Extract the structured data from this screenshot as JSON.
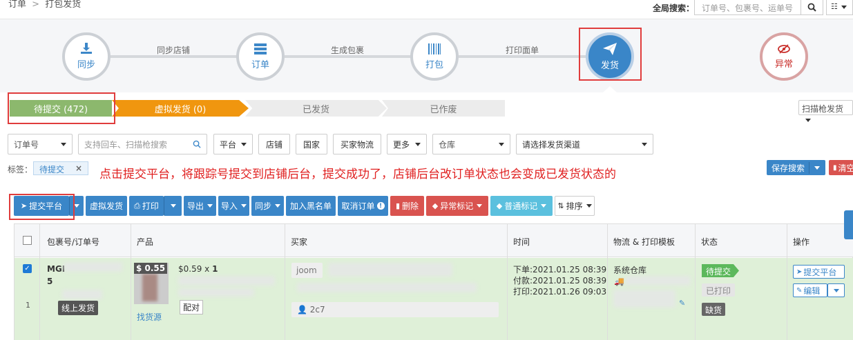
{
  "breadcrumb": {
    "root": "订单",
    "sep": ">",
    "current": "打包发货"
  },
  "global_search": {
    "label": "全局搜索：",
    "placeholder": "订单号、包裹号、运单号"
  },
  "workflow": {
    "steps": [
      {
        "label": "同步",
        "icon": "download-icon"
      },
      {
        "label": "订单",
        "icon": "list-icon"
      },
      {
        "label": "打包",
        "icon": "barcode-icon"
      },
      {
        "label": "发货",
        "icon": "paper-plane-icon"
      },
      {
        "label": "异常",
        "icon": "eye-slash-icon"
      }
    ],
    "connectors": [
      "同步店铺",
      "生成包裹",
      "打印面单"
    ]
  },
  "status_tabs": [
    {
      "label": "待提交 (472)",
      "color": "#8cb86d"
    },
    {
      "label": "虚拟发货 (0)",
      "color": "#f0960f"
    },
    {
      "label": "已发货",
      "color": "#ececec"
    },
    {
      "label": "已作废",
      "color": "#ececec"
    }
  ],
  "scan_ship": "扫描枪发货",
  "filters": {
    "order_no": "订单号",
    "search_placeholder": "支持回车、扫描枪搜索",
    "platform": "平台",
    "shop": "店铺",
    "country": "国家",
    "buyer_logistics": "买家物流",
    "more": "更多",
    "warehouse": "仓库",
    "channel": "请选择发货渠道"
  },
  "tags": {
    "label": "标签：",
    "chip": "待提交",
    "chip_close": "×"
  },
  "annotation_note": "点击提交平台，将跟踪号提交到店铺后台，提交成功了，店铺后台改订单状态也会变成已发货状态的",
  "save_search": "保存搜索",
  "clear": "清空",
  "actions": {
    "submit_platform": "提交平台",
    "virtual_ship": "虚拟发货",
    "print": "打印",
    "export": "导出",
    "import": "导入",
    "sync": "同步",
    "blacklist": "加入黑名单",
    "cancel_order": "取消订单",
    "delete": "删除",
    "abnormal_mark": "异常标记",
    "normal_mark": "普通标记",
    "sort": "排序"
  },
  "table": {
    "headers": [
      "包裹号/订单号",
      "产品",
      "买家",
      "时间",
      "物流 & 打印模板",
      "状态",
      "操作"
    ],
    "row": {
      "order_prefix": "MGI",
      "order_suffix": "5",
      "index": "1",
      "online_ship": "线上发货",
      "price_badge": "$ 0.55",
      "price_qty": "$0.59 x",
      "qty": "1",
      "match": "配对",
      "find_source": "找货源",
      "platform": "joom",
      "buyer_id": "2c7",
      "time_order": "下单:2021.01.25 08:39",
      "time_paid": "付款:2021.01.25 08:39",
      "time_print": "打印:2021.01.26 09:03",
      "warehouse": "系统仓库",
      "status_pending": "待提交",
      "status_printed": "已打印",
      "status_stockout": "缺货",
      "op_submit": "提交平台",
      "op_edit": "编辑"
    }
  },
  "colors": {
    "primary": "#3a86c8",
    "danger": "#d9534f",
    "info": "#5bc0de",
    "success": "#5cb85c",
    "annotation": "#e02020"
  }
}
